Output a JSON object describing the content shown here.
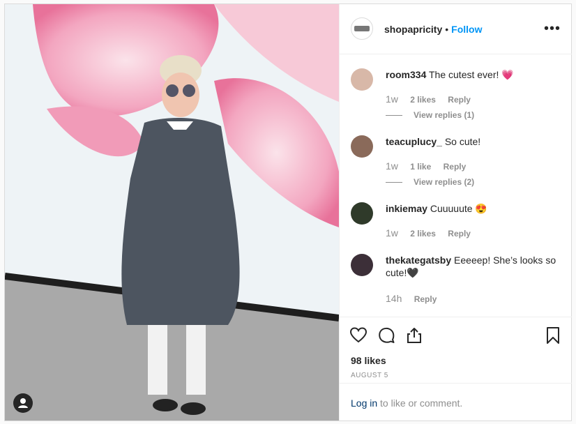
{
  "post": {
    "username": "shopapricity",
    "dot": "•",
    "follow_label": "Follow",
    "more_label": "•••",
    "likes": "98 likes",
    "date": "AUGUST 5",
    "login_link": "Log in",
    "login_suffix": " to like or comment."
  },
  "comments": [
    {
      "user": "room334",
      "text": "The cutest ever! 💗",
      "time": "1w",
      "likes": "2 likes",
      "reply": "Reply",
      "view_replies": "View replies (1)"
    },
    {
      "user": "teacuplucy_",
      "text": "So cute!",
      "time": "1w",
      "likes": "1 like",
      "reply": "Reply",
      "view_replies": "View replies (2)"
    },
    {
      "user": "inkiemay",
      "text": "Cuuuuute 😍",
      "time": "1w",
      "likes": "2 likes",
      "reply": "Reply",
      "view_replies": ""
    },
    {
      "user": "thekategatsby",
      "text": "Eeeeep! She’s looks so cute!🖤",
      "time": "14h",
      "likes": "",
      "reply": "Reply",
      "view_replies": ""
    }
  ],
  "icons": {
    "like": "heart-icon",
    "comment": "comment-icon",
    "share": "share-icon",
    "save": "bookmark-icon",
    "user_tag": "user-tag-icon"
  },
  "colors": {
    "link_blue": "#0095f6",
    "muted": "#8e8e8e",
    "text": "#262626"
  }
}
